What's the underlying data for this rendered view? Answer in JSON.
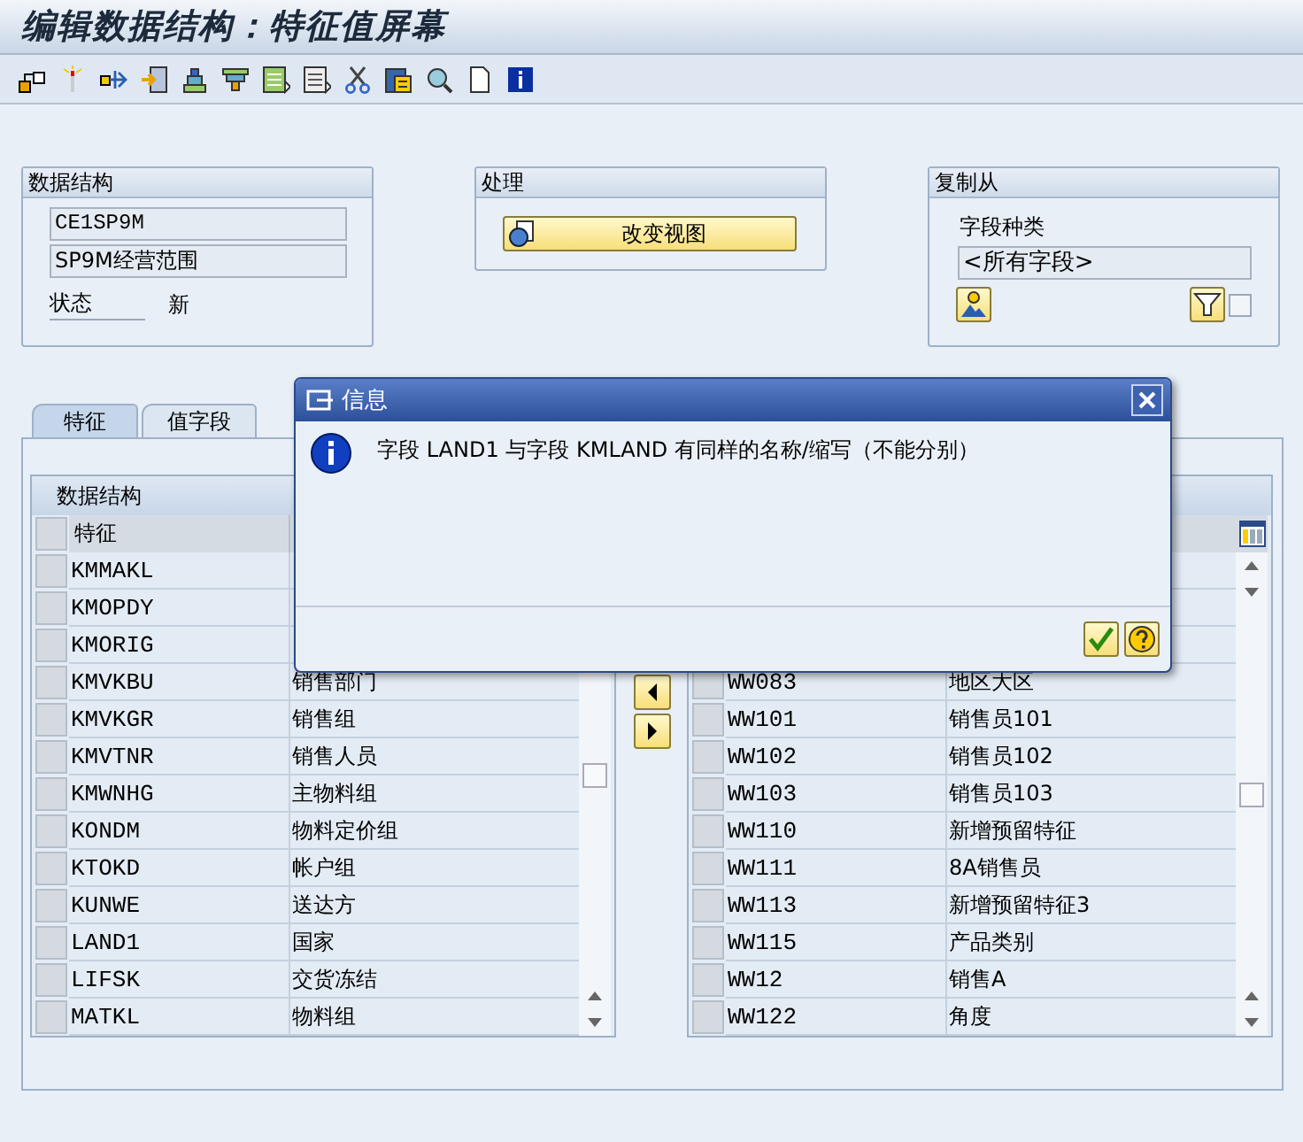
{
  "window": {
    "title": "编辑数据结构：特征值屏幕"
  },
  "data_structure": {
    "title": "数据结构",
    "fields": [
      "CE1SP9M",
      "SP9M经营范围"
    ],
    "status_label": "状态",
    "status_value": "新"
  },
  "processing": {
    "title": "处理",
    "button": "改变视图"
  },
  "copy_from": {
    "title": "复制从",
    "label": "字段种类",
    "value": "<所有字段>",
    "filter_checked": false
  },
  "tabs": [
    {
      "label": "特征",
      "selected": true
    },
    {
      "label": "值字段",
      "selected": false
    }
  ],
  "left_table": {
    "title": "数据结构",
    "column_1": "特征",
    "rows": [
      {
        "field": "KMMAKL"
      },
      {
        "field": "KMOPDY"
      },
      {
        "field": "KMORIG"
      },
      {
        "field": "KMVKBU",
        "text": "销售部门"
      },
      {
        "field": "KMVKGR",
        "text": "销售组"
      },
      {
        "field": "KMVTNR",
        "text": "销售人员"
      },
      {
        "field": "KMWNHG",
        "text": "主物料组"
      },
      {
        "field": "KONDM",
        "text": "物料定价组"
      },
      {
        "field": "KTOKD",
        "text": "帐户组"
      },
      {
        "field": "KUNWE",
        "text": "送达方"
      },
      {
        "field": "LAND1",
        "text": "国家"
      },
      {
        "field": "LIFSK",
        "text": "交货冻结"
      },
      {
        "field": "MATKL",
        "text": "物料组"
      }
    ]
  },
  "right_table": {
    "rows": [
      {
        "field": "WW083",
        "text": "地区大区"
      },
      {
        "field": "WW101",
        "text": "销售员101"
      },
      {
        "field": "WW102",
        "text": "销售员102"
      },
      {
        "field": "WW103",
        "text": "销售员103"
      },
      {
        "field": "WW110",
        "text": "新增预留特征"
      },
      {
        "field": "WW111",
        "text": "8A销售员"
      },
      {
        "field": "WW113",
        "text": "新增预留特征3"
      },
      {
        "field": "WW115",
        "text": "产品类别"
      },
      {
        "field": "WW12",
        "text": "销售A"
      },
      {
        "field": "WW122",
        "text": "角度"
      }
    ]
  },
  "dialog": {
    "title": "信息",
    "message": "字段 LAND1 与字段 KMLAND 有同样的名称/缩写（不能分别）"
  }
}
